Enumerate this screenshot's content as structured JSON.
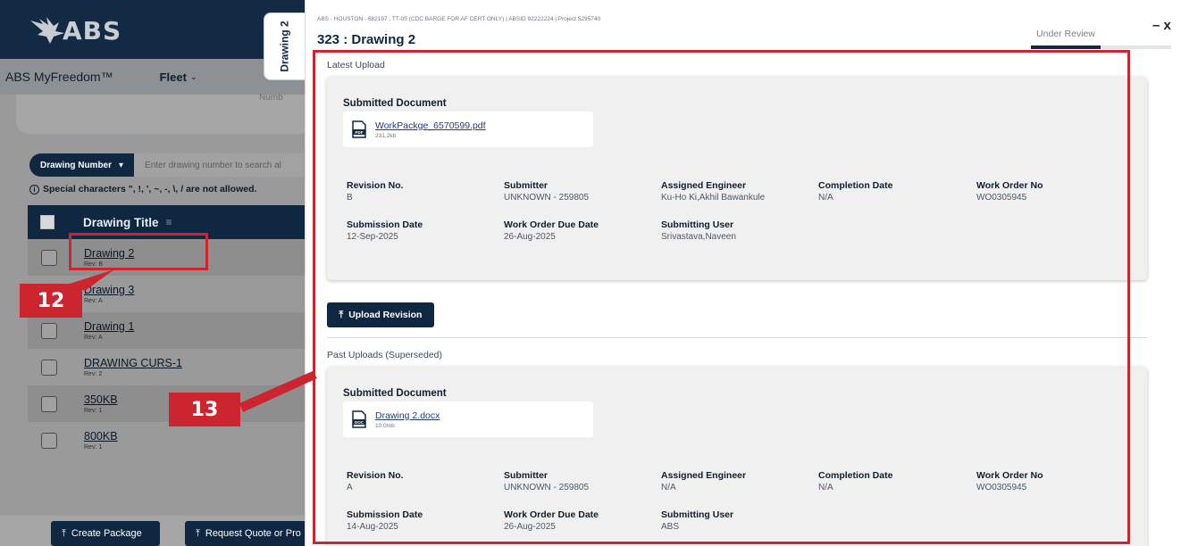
{
  "app": {
    "logo_text": "ABS",
    "brand": "ABS MyFreedom™",
    "nav_fleet": "Fleet",
    "partial_text": "Numb"
  },
  "search": {
    "dropdown_label": "Drawing Number",
    "placeholder": "Enter drawing number to search al",
    "note": "Special characters \", !, ', ~, -, \\, / are not allowed."
  },
  "table": {
    "header": "Drawing Title",
    "rows": [
      {
        "name": "Drawing 2",
        "rev": "Rev: B"
      },
      {
        "name": "Drawing 3",
        "rev": "Rev: A"
      },
      {
        "name": "Drawing 1",
        "rev": "Rev: A"
      },
      {
        "name": "DRAWING CURS-1",
        "rev": "Rev: 2"
      },
      {
        "name": "350KB",
        "rev": "Rev: 1"
      },
      {
        "name": "800KB",
        "rev": "Rev: 1"
      }
    ]
  },
  "bottom_buttons": {
    "create": "Create Package",
    "quote": "Request Quote or Pro"
  },
  "vertical_tab": "Drawing 2",
  "annotations": {
    "badge_12": "12",
    "badge_13": "13",
    "color": "#cc2530"
  },
  "drawer": {
    "project_line": "ABS - HOUSTON - 682197 , TT-05 (CDC BARGE FOR AF CERT ONLY) | ABSID 92222224 | Project 5295740",
    "title": "323 : Drawing 2",
    "close": "– x",
    "status_tab": "Under Review",
    "latest_label": "Latest Upload",
    "past_label": "Past Uploads (Superseded)",
    "upload_button": "Upload Revision",
    "latest": {
      "heading": "Submitted Document",
      "file_name": "WorkPackge_6570599.pdf",
      "file_size": "231.2kb",
      "file_type": "PDF",
      "fields": [
        {
          "label": "Revision No.",
          "value": "B"
        },
        {
          "label": "Submitter",
          "value": "UNKNOWN - 259805"
        },
        {
          "label": "Assigned Engineer",
          "value": "Ku-Ho Ki,Akhil Bawankule"
        },
        {
          "label": "Completion Date",
          "value": "N/A"
        },
        {
          "label": "Work Order No",
          "value": "WO0305945"
        },
        {
          "label": "Submission Date",
          "value": "12-Sep-2025"
        },
        {
          "label": "Work Order Due Date",
          "value": "26-Aug-2025"
        },
        {
          "label": "Submitting User",
          "value": "Srivastava,Naveen"
        }
      ]
    },
    "past": {
      "heading": "Submitted Document",
      "file_name": "Drawing 2.docx",
      "file_size": "10.0mb",
      "file_type": "DOC",
      "fields": [
        {
          "label": "Revision No.",
          "value": "A"
        },
        {
          "label": "Submitter",
          "value": "UNKNOWN - 259805"
        },
        {
          "label": "Assigned Engineer",
          "value": "N/A"
        },
        {
          "label": "Completion Date",
          "value": "N/A"
        },
        {
          "label": "Work Order No",
          "value": "WO0305945"
        },
        {
          "label": "Submission Date",
          "value": "14-Aug-2025"
        },
        {
          "label": "Work Order Due Date",
          "value": "26-Aug-2025"
        },
        {
          "label": "Submitting User",
          "value": "ABS"
        }
      ]
    }
  }
}
